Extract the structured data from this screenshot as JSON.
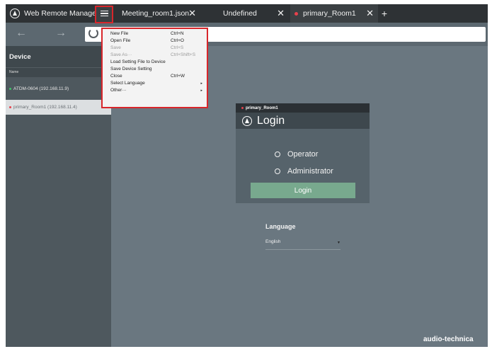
{
  "app": {
    "title": "Web Remote Manager"
  },
  "tabs": [
    {
      "label": "Meeting_room1.json",
      "close": "✕"
    },
    {
      "label": "Undefined",
      "close": "✕"
    },
    {
      "label": "primary_Room1",
      "close": "✕"
    }
  ],
  "new_tab": "+",
  "nav": {
    "back": "←",
    "forward": "→"
  },
  "sidebar": {
    "header": "Device",
    "column": "Name",
    "devices": [
      {
        "label": "ATDM-0604 (192.168.11.9)",
        "status_color": "#3fc46a"
      },
      {
        "label": "primary_Room1 (192.168.11.4)",
        "status_color": "#e8414c"
      }
    ]
  },
  "file_menu": {
    "items": [
      {
        "label": "New File",
        "shortcut": "Ctrl+N",
        "enabled": true
      },
      {
        "label": "Open File",
        "shortcut": "Ctrl+O",
        "enabled": true
      },
      {
        "label": "Save",
        "shortcut": "Ctrl+S",
        "enabled": false
      },
      {
        "label": "Save As···",
        "shortcut": "Ctrl+Shift+S",
        "enabled": false
      },
      {
        "label": "Load Setting File to Device",
        "shortcut": "",
        "enabled": true
      },
      {
        "label": "Save Device Setting",
        "shortcut": "",
        "enabled": true
      },
      {
        "label": "Close",
        "shortcut": "Ctrl+W",
        "enabled": true
      },
      {
        "label": "Select Language",
        "shortcut": "",
        "enabled": true,
        "submenu": "▸"
      },
      {
        "label": "Other···",
        "shortcut": "",
        "enabled": true,
        "submenu": "▸"
      }
    ]
  },
  "login": {
    "device": "primary_Room1",
    "title": "Login",
    "roles": [
      "Operator",
      "Administrator"
    ],
    "button": "Login"
  },
  "language": {
    "label": "Language",
    "value": "English",
    "caret": "▼"
  },
  "brand": "audio-technica",
  "colors": {
    "accent_red": "#d8262b",
    "login_green": "#78a98e"
  }
}
